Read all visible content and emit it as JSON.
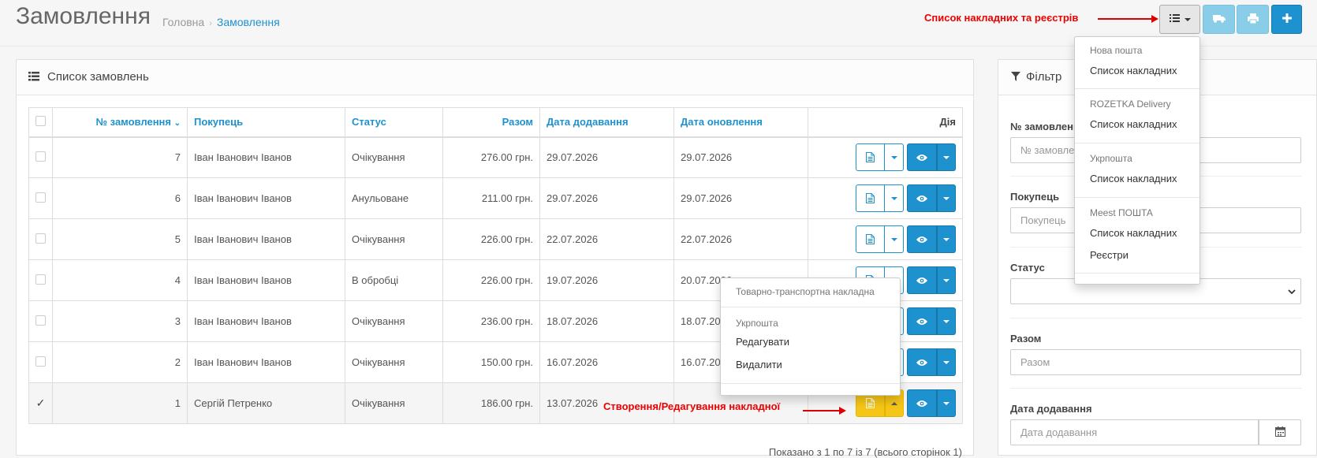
{
  "header": {
    "title": "Замовлення",
    "breadcrumb": [
      {
        "label": "Головна"
      },
      {
        "label": "Замовлення"
      }
    ],
    "annotation": "Список накладних та реєстрів",
    "buttons": [
      {
        "icon": "list-icon",
        "color": "#e6e6e6"
      },
      {
        "icon": "truck-icon",
        "color": "#8acde8"
      },
      {
        "icon": "print-icon",
        "color": "#8acde8"
      },
      {
        "icon": "plus-icon",
        "color": "#1e91cf"
      }
    ]
  },
  "top_dropdown": {
    "groups": [
      {
        "header": "Нова пошта",
        "items": [
          "Список накладних"
        ]
      },
      {
        "header": "ROZETKA Delivery",
        "items": [
          "Список накладних"
        ]
      },
      {
        "header": "Укрпошта",
        "items": [
          "Список накладних"
        ]
      },
      {
        "header": "Meest ПОШТА",
        "items": [
          "Список накладних",
          "Реєстри"
        ]
      }
    ]
  },
  "orders_panel": {
    "title": "Список замовлень",
    "columns": [
      "№ замовлення",
      "Покупець",
      "Статус",
      "Разом",
      "Дата додавання",
      "Дата оновлення",
      "Дія"
    ],
    "rows": [
      {
        "id": "7",
        "customer": "Іван Іванович Іванов",
        "status": "Очікування",
        "total": "276.00 грн.",
        "added": "29.07.2026",
        "updated": "29.07.2026"
      },
      {
        "id": "6",
        "customer": "Іван Іванович Іванов",
        "status": "Анульоване",
        "total": "211.00 грн.",
        "added": "29.07.2026",
        "updated": "29.07.2026"
      },
      {
        "id": "5",
        "customer": "Іван Іванович Іванов",
        "status": "Очікування",
        "total": "226.00 грн.",
        "added": "22.07.2026",
        "updated": "22.07.2026"
      },
      {
        "id": "4",
        "customer": "Іван Іванович Іванов",
        "status": "В обробці",
        "total": "226.00 грн.",
        "added": "19.07.2026",
        "updated": "20.07.2026"
      },
      {
        "id": "3",
        "customer": "Іван Іванович Іванов",
        "status": "Очікування",
        "total": "236.00 грн.",
        "added": "18.07.2026",
        "updated": "18.07.2026"
      },
      {
        "id": "2",
        "customer": "Іван Іванович Іванов",
        "status": "Очікування",
        "total": "150.00 грн.",
        "added": "16.07.2026",
        "updated": "16.07.2026"
      },
      {
        "id": "1",
        "customer": "Сергій Петренко",
        "status": "Очікування",
        "total": "186.00 грн.",
        "added": "13.07.2026",
        "updated": ""
      }
    ],
    "pagination_text": "Показано з 1 по 7 із 7 (всього сторінок 1)",
    "row_annotation": "Створення/Редагування накладної"
  },
  "row_dropdown": {
    "ttn_header": "Товарно-транспортна накладна",
    "group_header": "Укрпошта",
    "items": [
      "Редагувати",
      "Видалити"
    ]
  },
  "filter": {
    "title": "Фільтр",
    "fields": [
      {
        "label": "№ замовлення",
        "placeholder": "№ замовлення"
      },
      {
        "label": "Покупець",
        "placeholder": "Покупець"
      },
      {
        "label": "Статус",
        "placeholder": ""
      },
      {
        "label": "Разом",
        "placeholder": "Разом"
      },
      {
        "label": "Дата додавання",
        "placeholder": "Дата додавання"
      }
    ]
  }
}
